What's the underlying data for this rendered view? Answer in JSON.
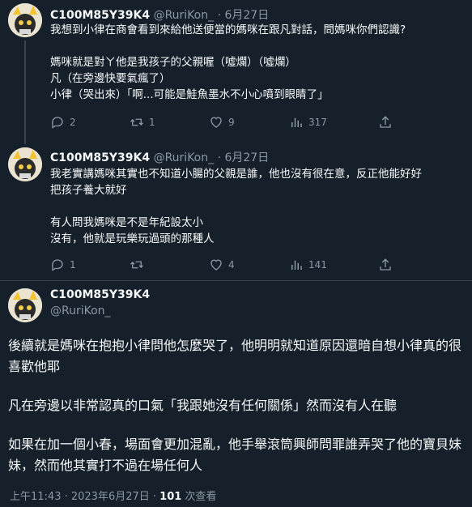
{
  "tweets": [
    {
      "name": "C100M85Y39K4",
      "handle": "@RuriKon_",
      "date": "· 6月27日",
      "lines": [
        "我想到小律在商會看到來給他送便當的媽咪在跟凡對話，問媽咪你們認識?",
        "",
        "媽咪就是對ㄚ他是我孩子的父親喔（噓爛）（噓爛）",
        "凡（在旁邊快要氣瘋了）",
        "小律（哭出來）「啊...可能是鮭魚墨水不小心噴到眼睛了」"
      ],
      "replies": "2",
      "retweets": "1",
      "likes": "9",
      "views": "317"
    },
    {
      "name": "C100M85Y39K4",
      "handle": "@RuriKon_",
      "date": "· 6月27日",
      "lines": [
        "我老實講媽咪其實也不知道小腸的父親是誰，他也沒有很在意，反正他能好好",
        "把孩子養大就好",
        "",
        "有人問我媽咪是不是年紀設太小",
        "沒有，他就是玩樂玩過頭的那種人"
      ],
      "replies": "1",
      "retweets": "",
      "likes": "4",
      "views": "141"
    }
  ],
  "main": {
    "name": "C100M85Y39K4",
    "handle": "@RuriKon_",
    "paragraphs": [
      "後續就是媽咪在抱抱小律問他怎麼哭了，他明明就知道原因還暗自想小律真的很喜歡他耶",
      "凡在旁邊以非常認真的口氣「我跟她沒有任何關係」然而沒有人在聽",
      "如果在加一個小春，場面會更加混亂，他手舉滾筒興師問罪誰弄哭了他的寶貝妹妹，然而他其實打不過在場任何人"
    ],
    "time": "上午11:43 · 2023年6月27日 · ",
    "views_count": "101",
    "views_label": " 次查看"
  }
}
